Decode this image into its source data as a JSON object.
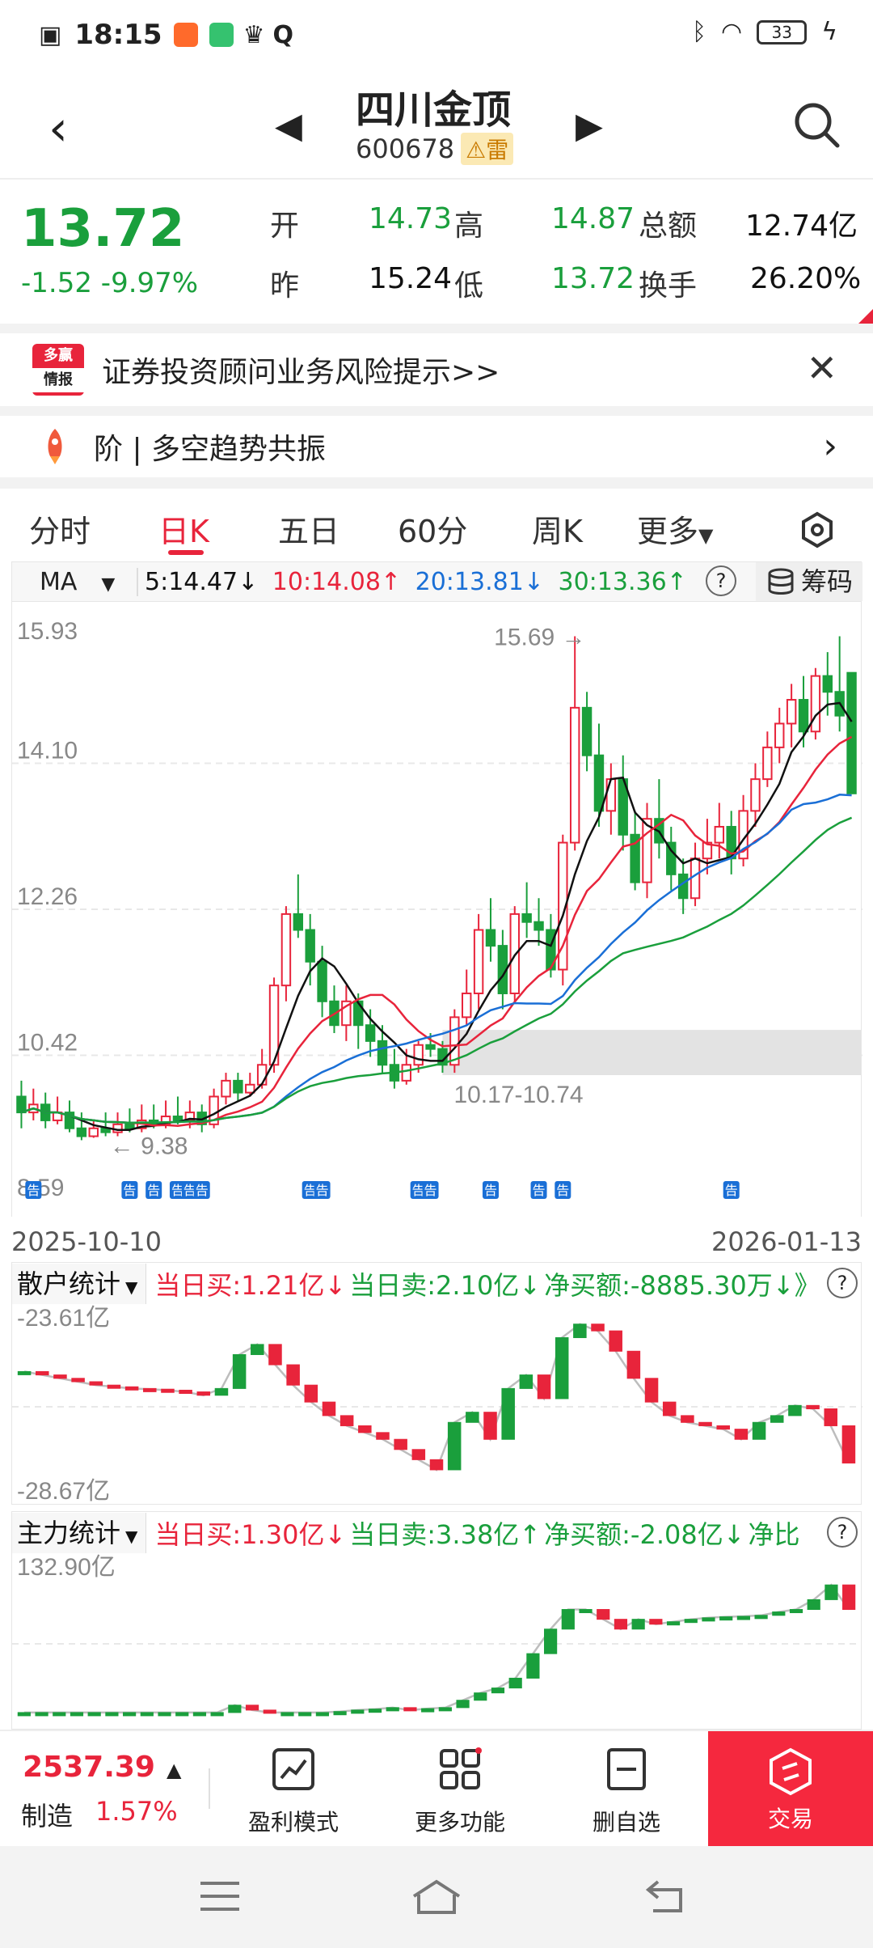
{
  "status_bar": {
    "time": "18:15",
    "battery": "33"
  },
  "header": {
    "stock_name": "四川金顶",
    "stock_code": "600678",
    "risk_badge": "雷"
  },
  "quote": {
    "price": "13.72",
    "change": "-1.52",
    "change_pct": "-9.97%",
    "open_label": "开",
    "open": "14.73",
    "high_label": "高",
    "high": "14.87",
    "turnover_amt_label": "总额",
    "turnover_amt": "12.74亿",
    "prev_close_label": "昨",
    "prev_close": "15.24",
    "low_label": "低",
    "low": "13.72",
    "turnover_rate_label": "换手",
    "turnover_rate": "26.20%"
  },
  "risk_banner": {
    "logo_line1": "多赢",
    "logo_line2": "情报",
    "text": "证券投资顾问业务风险提示>>"
  },
  "trend_banner": {
    "text": "阶 | 多空趋势共振"
  },
  "tabs": [
    {
      "label": "分时"
    },
    {
      "label": "日K"
    },
    {
      "label": "五日"
    },
    {
      "label": "60分"
    },
    {
      "label": "周K"
    },
    {
      "label": "更多"
    }
  ],
  "ma_bar": {
    "selector": "MA",
    "ma5": "5:14.47↓",
    "ma10": "10:14.08↑",
    "ma20": "20:13.81↓",
    "ma30": "30:13.36↑",
    "chip_label": "筹码",
    "colors": {
      "ma5": "#111111",
      "ma10": "#e8243b",
      "ma20": "#1a6fd6",
      "ma30": "#1a9f3c"
    }
  },
  "chart_data": [
    {
      "type": "candlestick",
      "y_ticks": [
        "15.93",
        "14.10",
        "12.26",
        "10.42",
        "8.59"
      ],
      "ylim": [
        8.59,
        15.93
      ],
      "x_start": "2025-10-10",
      "x_end": "2026-01-13",
      "annotations": {
        "high_marker": "15.69",
        "low_marker": "9.38",
        "zone": "10.17-10.74",
        "notice_label": "告"
      },
      "candles": [
        [
          9.9,
          9.7,
          10.1,
          9.5
        ],
        [
          9.7,
          9.8,
          10.0,
          9.6
        ],
        [
          9.8,
          9.6,
          9.95,
          9.5
        ],
        [
          9.6,
          9.7,
          9.9,
          9.55
        ],
        [
          9.7,
          9.5,
          9.85,
          9.45
        ],
        [
          9.5,
          9.4,
          9.7,
          9.35
        ],
        [
          9.4,
          9.5,
          9.6,
          9.38
        ],
        [
          9.5,
          9.45,
          9.7,
          9.4
        ],
        [
          9.45,
          9.55,
          9.7,
          9.4
        ],
        [
          9.55,
          9.5,
          9.75,
          9.45
        ],
        [
          9.5,
          9.6,
          9.8,
          9.45
        ],
        [
          9.6,
          9.55,
          9.8,
          9.5
        ],
        [
          9.55,
          9.65,
          9.85,
          9.5
        ],
        [
          9.65,
          9.6,
          9.9,
          9.55
        ],
        [
          9.6,
          9.7,
          9.85,
          9.5
        ],
        [
          9.7,
          9.55,
          9.8,
          9.45
        ],
        [
          9.55,
          9.9,
          10.0,
          9.5
        ],
        [
          9.9,
          10.1,
          10.2,
          9.8
        ],
        [
          10.1,
          9.95,
          10.2,
          9.85
        ],
        [
          9.95,
          10.05,
          10.2,
          9.9
        ],
        [
          10.05,
          10.3,
          10.5,
          10.0
        ],
        [
          10.3,
          11.3,
          11.4,
          10.2
        ],
        [
          11.3,
          12.2,
          12.3,
          11.1
        ],
        [
          12.2,
          12.0,
          12.7,
          11.9
        ],
        [
          12.0,
          11.6,
          12.2,
          11.3
        ],
        [
          11.6,
          11.1,
          11.8,
          10.9
        ],
        [
          11.1,
          10.8,
          11.3,
          10.7
        ],
        [
          10.8,
          11.1,
          11.3,
          10.6
        ],
        [
          11.1,
          10.8,
          11.2,
          10.5
        ],
        [
          10.8,
          10.6,
          11.0,
          10.4
        ],
        [
          10.6,
          10.3,
          10.8,
          10.2
        ],
        [
          10.3,
          10.1,
          10.5,
          10.0
        ],
        [
          10.1,
          10.3,
          10.5,
          10.05
        ],
        [
          10.3,
          10.55,
          10.6,
          10.2
        ],
        [
          10.55,
          10.5,
          10.7,
          10.4
        ],
        [
          10.5,
          10.3,
          10.6,
          10.2
        ],
        [
          10.3,
          10.9,
          11.0,
          10.2
        ],
        [
          10.9,
          11.2,
          11.5,
          10.8
        ],
        [
          11.2,
          12.0,
          12.2,
          11.0
        ],
        [
          12.0,
          11.8,
          12.4,
          11.6
        ],
        [
          11.8,
          11.2,
          12.0,
          11.0
        ],
        [
          11.2,
          12.2,
          12.3,
          11.1
        ],
        [
          12.2,
          12.1,
          12.6,
          11.9
        ],
        [
          12.1,
          12.0,
          12.4,
          11.8
        ],
        [
          12.0,
          11.5,
          12.2,
          11.4
        ],
        [
          11.5,
          13.1,
          13.2,
          11.3
        ],
        [
          13.1,
          14.8,
          15.7,
          13.0
        ],
        [
          14.8,
          14.2,
          15.0,
          14.0
        ],
        [
          14.2,
          13.5,
          14.6,
          13.3
        ],
        [
          13.5,
          13.9,
          14.1,
          13.2
        ],
        [
          13.9,
          13.2,
          14.2,
          13.0
        ],
        [
          13.2,
          12.6,
          13.5,
          12.5
        ],
        [
          12.6,
          13.4,
          13.6,
          12.4
        ],
        [
          13.4,
          13.1,
          13.9,
          12.9
        ],
        [
          13.1,
          12.7,
          13.3,
          12.5
        ],
        [
          12.7,
          12.4,
          12.9,
          12.2
        ],
        [
          12.4,
          12.9,
          13.1,
          12.3
        ],
        [
          12.9,
          13.1,
          13.4,
          12.7
        ],
        [
          13.1,
          13.3,
          13.6,
          12.9
        ],
        [
          13.3,
          12.9,
          13.5,
          12.7
        ],
        [
          12.9,
          13.5,
          13.7,
          12.8
        ],
        [
          13.5,
          13.9,
          14.1,
          13.3
        ],
        [
          13.9,
          14.3,
          14.5,
          13.8
        ],
        [
          14.3,
          14.6,
          14.8,
          14.1
        ],
        [
          14.6,
          14.9,
          15.1,
          14.3
        ],
        [
          14.9,
          14.5,
          15.2,
          14.3
        ],
        [
          14.5,
          15.2,
          15.3,
          14.4
        ],
        [
          15.2,
          15.0,
          15.5,
          14.7
        ],
        [
          15.0,
          14.7,
          15.7,
          14.5
        ],
        [
          15.24,
          13.72,
          14.87,
          13.72
        ]
      ]
    },
    {
      "type": "line",
      "title": "散户统计",
      "series_text": {
        "buy": "当日买:1.21亿↓",
        "sell": "当日卖:2.10亿↓",
        "net": "净买额:-8885.30万↓",
        "more": "》"
      },
      "y_top_label": "-23.61亿",
      "y_bottom_label": "-28.67亿",
      "ylim": [
        -28.67,
        -23.61
      ],
      "values": [
        -25.1,
        -25.2,
        -25.3,
        -25.4,
        -25.5,
        -25.55,
        -25.6,
        -25.62,
        -25.65,
        -25.7,
        -25.8,
        -25.6,
        -24.6,
        -24.3,
        -24.9,
        -25.5,
        -26.0,
        -26.4,
        -26.7,
        -26.9,
        -27.1,
        -27.4,
        -27.7,
        -28.0,
        -26.6,
        -26.3,
        -27.1,
        -25.6,
        -25.2,
        -25.9,
        -24.1,
        -23.7,
        -23.9,
        -24.5,
        -25.3,
        -26.0,
        -26.4,
        -26.6,
        -26.7,
        -26.8,
        -27.1,
        -26.6,
        -26.4,
        -26.1,
        -26.2,
        -26.7,
        -27.8
      ]
    },
    {
      "type": "line",
      "title": "主力统计",
      "series_text": {
        "buy": "当日买:1.30亿↓",
        "sell": "当日卖:3.38亿↑",
        "net": "净买额:-2.08亿↓",
        "more": "净比"
      },
      "y_top_label": "132.90亿",
      "ylim": [
        105,
        135
      ],
      "values": [
        106,
        106,
        106,
        106,
        106,
        106,
        106,
        106,
        106,
        106,
        106,
        106,
        107.5,
        106.5,
        106,
        106,
        106,
        106,
        106.2,
        106.5,
        106.7,
        107,
        106.5,
        106.8,
        107,
        108.5,
        110,
        111,
        113,
        118,
        123,
        127,
        127,
        125,
        123,
        125,
        124,
        124.5,
        125,
        125.3,
        125.5,
        125.6,
        125.8,
        126.5,
        127,
        129,
        132,
        127
      ]
    }
  ],
  "bottom_bar": {
    "index_value": "2537.39",
    "index_arrow": "▲",
    "index_name": "制造",
    "index_pct": "1.57%",
    "profit_mode": "盈利模式",
    "more_features": "更多功能",
    "remove_watchlist": "删自选",
    "trade": "交易"
  }
}
